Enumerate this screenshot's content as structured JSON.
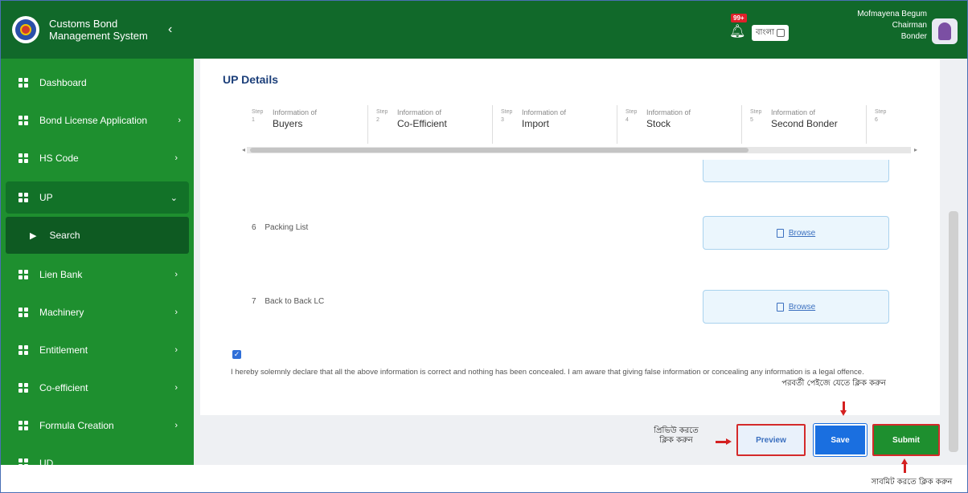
{
  "app": {
    "title": "Customs Bond Management System",
    "collapse_icon": "chevron-left-icon"
  },
  "header": {
    "notification_count": "99+",
    "language_label": "বাংলা",
    "user_name": "Mofmayena Begum",
    "user_role": "Chairman",
    "user_org": "Bonder"
  },
  "sidebar": {
    "items": [
      {
        "label": "Dashboard"
      },
      {
        "label": "Bond License Application"
      },
      {
        "label": "HS Code"
      },
      {
        "label": "UP"
      },
      {
        "label": "Search"
      },
      {
        "label": "Lien Bank"
      },
      {
        "label": "Machinery"
      },
      {
        "label": "Entitlement"
      },
      {
        "label": "Co-efficient"
      },
      {
        "label": "Formula Creation"
      },
      {
        "label": "UD"
      }
    ]
  },
  "page": {
    "title": "UP Details",
    "steps": [
      {
        "num": "Step 1",
        "small": "Information of",
        "big": "Buyers"
      },
      {
        "num": "Step 2",
        "small": "Information of",
        "big": "Co-Efficient"
      },
      {
        "num": "Step 3",
        "small": "Information of",
        "big": "Import"
      },
      {
        "num": "Step 4",
        "small": "Information of",
        "big": "Stock"
      },
      {
        "num": "Step 5",
        "small": "Information of",
        "big": "Second Bonder"
      },
      {
        "num": "Step 6",
        "small": "",
        "big": ""
      }
    ],
    "documents": [
      {
        "num": "6",
        "label": "Packing List",
        "browse": "Browse"
      },
      {
        "num": "7",
        "label": "Back to Back LC",
        "browse": "Browse"
      }
    ],
    "declaration": "I hereby solemnly declare that all the above information is correct and nothing has been concealed. I am aware that giving false information or concealing any information is a legal offence.",
    "declaration_checked": true
  },
  "actions": {
    "preview": "Preview",
    "save": "Save",
    "submit": "Submit"
  },
  "annotations": {
    "preview_note": "প্রিভিউ করতে ক্লিক করুন",
    "save_note": "পরবর্তী পেইজে যেতে ক্লিক করুন",
    "submit_note": "সাবমিট করতে ক্লিক করুন"
  },
  "colors": {
    "primary_green": "#1e8f2f",
    "dark_green": "#11692a",
    "save_blue": "#1a6fe0",
    "highlight_red": "#d42a2a"
  }
}
